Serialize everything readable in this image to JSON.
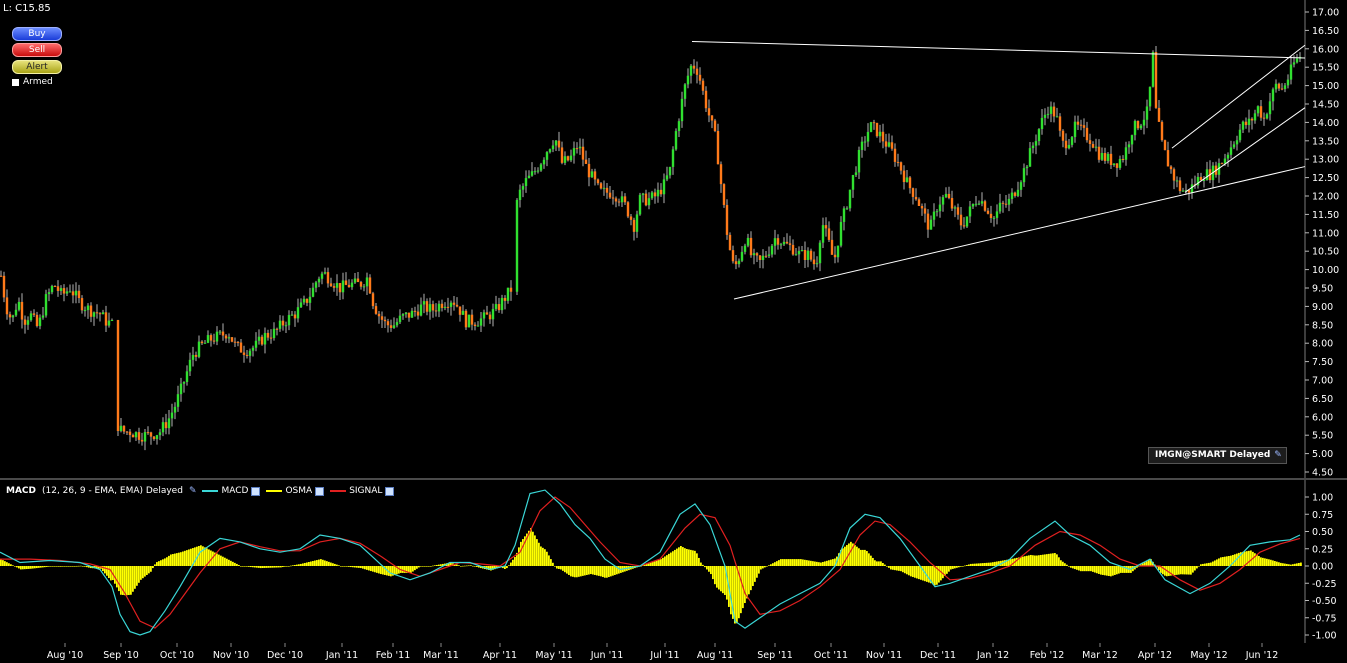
{
  "header": {
    "last_price": "L: C15.85"
  },
  "order_buttons": {
    "buy": "Buy",
    "sell": "Sell",
    "alert": "Alert",
    "armed": "Armed"
  },
  "ticker": {
    "label": "IMGN@SMART Delayed"
  },
  "macd_legend": {
    "title": "MACD",
    "params": "(12, 26, 9 - EMA, EMA) Delayed",
    "macd": "MACD",
    "osma": "OSMA",
    "signal": "SIGNAL"
  },
  "colors": {
    "up": "#30e030",
    "down": "#ff7a1a",
    "macd": "#3ad6d6",
    "signal": "#e02020",
    "osma": "#ffff00",
    "trendline": "#ffffff"
  },
  "chart_data": {
    "type": "candlestick",
    "x_labels": [
      "Aug '10",
      "Sep '10",
      "Oct '10",
      "Nov '10",
      "Dec '10",
      "Jan '11",
      "Feb '11",
      "Mar '11",
      "Apr '11",
      "May '11",
      "Jun '11",
      "Jul '11",
      "Aug '11",
      "Sep '11",
      "Oct '11",
      "Nov '11",
      "Dec '11",
      "Jan '12",
      "Feb '12",
      "Mar '12",
      "Apr '12",
      "May '12",
      "Jun '12"
    ],
    "price_axis": {
      "ylim": [
        4.5,
        17.0
      ],
      "ticks": [
        "17.00",
        "16.50",
        "16.00",
        "15.50",
        "15.00",
        "14.50",
        "14.00",
        "13.50",
        "13.00",
        "12.50",
        "12.00",
        "11.50",
        "11.00",
        "10.50",
        "10.00",
        "9.50",
        "9.00",
        "8.50",
        "8.00",
        "7.50",
        "7.00",
        "6.50",
        "6.00",
        "5.50",
        "5.00",
        "4.50"
      ]
    },
    "price_path": [
      [
        0,
        10.0
      ],
      [
        6,
        9.0
      ],
      [
        12,
        8.6
      ],
      [
        18,
        9.2
      ],
      [
        24,
        8.6
      ],
      [
        30,
        8.8
      ],
      [
        38,
        8.4
      ],
      [
        46,
        9.2
      ],
      [
        54,
        9.6
      ],
      [
        62,
        9.3
      ],
      [
        70,
        9.5
      ],
      [
        80,
        9.1
      ],
      [
        90,
        8.9
      ],
      [
        100,
        8.8
      ],
      [
        106,
        8.6
      ],
      [
        113,
        8.5
      ],
      [
        117,
        5.8
      ],
      [
        122,
        5.6
      ],
      [
        130,
        5.6
      ],
      [
        140,
        5.5
      ],
      [
        150,
        5.5
      ],
      [
        160,
        5.6
      ],
      [
        168,
        5.9
      ],
      [
        175,
        6.3
      ],
      [
        182,
        6.8
      ],
      [
        188,
        7.3
      ],
      [
        193,
        7.7
      ],
      [
        200,
        7.9
      ],
      [
        210,
        8.1
      ],
      [
        220,
        8.2
      ],
      [
        228,
        8.3
      ],
      [
        236,
        7.9
      ],
      [
        245,
        7.8
      ],
      [
        255,
        7.9
      ],
      [
        265,
        8.2
      ],
      [
        275,
        8.3
      ],
      [
        285,
        8.6
      ],
      [
        295,
        8.8
      ],
      [
        305,
        9.1
      ],
      [
        312,
        9.4
      ],
      [
        318,
        9.8
      ],
      [
        324,
        9.9
      ],
      [
        332,
        9.7
      ],
      [
        340,
        9.5
      ],
      [
        350,
        9.6
      ],
      [
        360,
        9.6
      ],
      [
        368,
        9.8
      ],
      [
        372,
        9.2
      ],
      [
        378,
        8.8
      ],
      [
        386,
        8.5
      ],
      [
        394,
        8.5
      ],
      [
        402,
        8.7
      ],
      [
        412,
        8.8
      ],
      [
        422,
        9.0
      ],
      [
        432,
        8.9
      ],
      [
        442,
        9.1
      ],
      [
        452,
        9.2
      ],
      [
        458,
        9.0
      ],
      [
        466,
        8.6
      ],
      [
        476,
        8.6
      ],
      [
        486,
        8.7
      ],
      [
        496,
        8.9
      ],
      [
        504,
        9.2
      ],
      [
        512,
        9.5
      ],
      [
        515,
        11.6
      ],
      [
        520,
        12.1
      ],
      [
        526,
        12.4
      ],
      [
        533,
        12.6
      ],
      [
        540,
        12.9
      ],
      [
        548,
        13.3
      ],
      [
        555,
        13.6
      ],
      [
        562,
        12.9
      ],
      [
        570,
        13.0
      ],
      [
        578,
        13.4
      ],
      [
        586,
        12.8
      ],
      [
        592,
        12.5
      ],
      [
        600,
        12.1
      ],
      [
        610,
        12.1
      ],
      [
        618,
        12.0
      ],
      [
        626,
        11.7
      ],
      [
        634,
        11.2
      ],
      [
        640,
        11.9
      ],
      [
        648,
        11.9
      ],
      [
        656,
        12.0
      ],
      [
        664,
        12.3
      ],
      [
        670,
        12.7
      ],
      [
        675,
        13.6
      ],
      [
        680,
        14.3
      ],
      [
        686,
        15.1
      ],
      [
        692,
        15.6
      ],
      [
        698,
        15.4
      ],
      [
        704,
        14.7
      ],
      [
        710,
        14.1
      ],
      [
        716,
        13.5
      ],
      [
        722,
        12.1
      ],
      [
        728,
        10.8
      ],
      [
        734,
        10.0
      ],
      [
        740,
        10.4
      ],
      [
        746,
        10.9
      ],
      [
        752,
        10.3
      ],
      [
        760,
        10.2
      ],
      [
        768,
        10.5
      ],
      [
        776,
        10.9
      ],
      [
        784,
        10.7
      ],
      [
        792,
        10.6
      ],
      [
        800,
        10.4
      ],
      [
        808,
        10.4
      ],
      [
        816,
        10.1
      ],
      [
        822,
        11.3
      ],
      [
        828,
        10.8
      ],
      [
        834,
        10.2
      ],
      [
        840,
        11.1
      ],
      [
        846,
        11.7
      ],
      [
        852,
        12.4
      ],
      [
        858,
        13.0
      ],
      [
        864,
        13.5
      ],
      [
        870,
        13.9
      ],
      [
        876,
        13.8
      ],
      [
        884,
        13.5
      ],
      [
        892,
        13.2
      ],
      [
        900,
        12.8
      ],
      [
        908,
        12.3
      ],
      [
        916,
        12.0
      ],
      [
        922,
        11.6
      ],
      [
        930,
        11.1
      ],
      [
        938,
        11.8
      ],
      [
        946,
        12.0
      ],
      [
        954,
        11.6
      ],
      [
        962,
        11.2
      ],
      [
        970,
        11.6
      ],
      [
        978,
        12.0
      ],
      [
        986,
        11.7
      ],
      [
        994,
        11.4
      ],
      [
        1000,
        11.7
      ],
      [
        1008,
        11.8
      ],
      [
        1016,
        12.2
      ],
      [
        1024,
        12.7
      ],
      [
        1032,
        13.3
      ],
      [
        1040,
        13.9
      ],
      [
        1048,
        14.4
      ],
      [
        1056,
        14.2
      ],
      [
        1062,
        13.4
      ],
      [
        1068,
        13.5
      ],
      [
        1076,
        13.9
      ],
      [
        1084,
        13.7
      ],
      [
        1092,
        13.5
      ],
      [
        1100,
        13.1
      ],
      [
        1108,
        13.0
      ],
      [
        1116,
        12.9
      ],
      [
        1124,
        13.1
      ],
      [
        1132,
        13.8
      ],
      [
        1140,
        14.0
      ],
      [
        1148,
        14.3
      ],
      [
        1153,
        15.8
      ],
      [
        1156,
        14.3
      ],
      [
        1162,
        13.4
      ],
      [
        1168,
        12.9
      ],
      [
        1174,
        12.5
      ],
      [
        1180,
        12.2
      ],
      [
        1186,
        12.1
      ],
      [
        1194,
        12.3
      ],
      [
        1202,
        12.6
      ],
      [
        1210,
        12.6
      ],
      [
        1218,
        12.8
      ],
      [
        1226,
        13.1
      ],
      [
        1234,
        13.5
      ],
      [
        1242,
        13.9
      ],
      [
        1250,
        14.0
      ],
      [
        1258,
        14.4
      ],
      [
        1264,
        14.1
      ],
      [
        1270,
        14.6
      ],
      [
        1276,
        15.0
      ],
      [
        1282,
        14.9
      ],
      [
        1288,
        15.2
      ],
      [
        1294,
        15.6
      ],
      [
        1300,
        15.8
      ]
    ],
    "trendlines": [
      {
        "name": "upper-resistance",
        "from": [
          692,
          16.2
        ],
        "to": [
          1305,
          15.75
        ]
      },
      {
        "name": "lower-support",
        "from": [
          734,
          9.2
        ],
        "to": [
          1305,
          12.8
        ]
      },
      {
        "name": "channel-top",
        "from": [
          1172,
          13.3
        ],
        "to": [
          1305,
          16.1
        ]
      },
      {
        "name": "channel-bottom",
        "from": [
          1185,
          12.1
        ],
        "to": [
          1305,
          14.4
        ]
      }
    ],
    "macd_axis": {
      "ylim": [
        -1.0,
        1.0
      ],
      "ticks": [
        "1.00",
        "0.75",
        "0.50",
        "0.25",
        "0.00",
        "-0.25",
        "-0.50",
        "-0.75",
        "-1.00"
      ]
    },
    "macd_path": [
      [
        0,
        0.2
      ],
      [
        20,
        0.05
      ],
      [
        50,
        0.08
      ],
      [
        80,
        0.05
      ],
      [
        100,
        -0.05
      ],
      [
        112,
        -0.3
      ],
      [
        120,
        -0.7
      ],
      [
        130,
        -0.95
      ],
      [
        140,
        -1.0
      ],
      [
        150,
        -0.95
      ],
      [
        165,
        -0.65
      ],
      [
        180,
        -0.3
      ],
      [
        200,
        0.2
      ],
      [
        220,
        0.4
      ],
      [
        240,
        0.35
      ],
      [
        260,
        0.25
      ],
      [
        280,
        0.2
      ],
      [
        300,
        0.25
      ],
      [
        320,
        0.45
      ],
      [
        340,
        0.4
      ],
      [
        360,
        0.3
      ],
      [
        375,
        0.1
      ],
      [
        390,
        -0.1
      ],
      [
        410,
        -0.2
      ],
      [
        430,
        -0.1
      ],
      [
        450,
        0.05
      ],
      [
        470,
        0.05
      ],
      [
        490,
        -0.05
      ],
      [
        505,
        0.0
      ],
      [
        515,
        0.3
      ],
      [
        530,
        1.05
      ],
      [
        545,
        1.1
      ],
      [
        560,
        0.9
      ],
      [
        575,
        0.6
      ],
      [
        590,
        0.4
      ],
      [
        605,
        0.1
      ],
      [
        620,
        -0.05
      ],
      [
        640,
        0.0
      ],
      [
        660,
        0.2
      ],
      [
        680,
        0.75
      ],
      [
        695,
        0.9
      ],
      [
        710,
        0.6
      ],
      [
        725,
        0.0
      ],
      [
        735,
        -0.8
      ],
      [
        745,
        -0.9
      ],
      [
        760,
        -0.75
      ],
      [
        780,
        -0.55
      ],
      [
        800,
        -0.4
      ],
      [
        820,
        -0.25
      ],
      [
        835,
        0.0
      ],
      [
        850,
        0.55
      ],
      [
        865,
        0.75
      ],
      [
        880,
        0.7
      ],
      [
        900,
        0.4
      ],
      [
        920,
        0.0
      ],
      [
        935,
        -0.3
      ],
      [
        950,
        -0.25
      ],
      [
        970,
        -0.15
      ],
      [
        990,
        -0.05
      ],
      [
        1010,
        0.1
      ],
      [
        1030,
        0.4
      ],
      [
        1055,
        0.65
      ],
      [
        1070,
        0.45
      ],
      [
        1090,
        0.3
      ],
      [
        1110,
        0.05
      ],
      [
        1130,
        -0.05
      ],
      [
        1150,
        0.1
      ],
      [
        1165,
        -0.2
      ],
      [
        1190,
        -0.4
      ],
      [
        1210,
        -0.25
      ],
      [
        1230,
        0.0
      ],
      [
        1250,
        0.3
      ],
      [
        1270,
        0.35
      ],
      [
        1290,
        0.38
      ],
      [
        1300,
        0.45
      ]
    ],
    "signal_path": [
      [
        0,
        0.1
      ],
      [
        30,
        0.1
      ],
      [
        60,
        0.08
      ],
      [
        90,
        0.03
      ],
      [
        110,
        -0.05
      ],
      [
        125,
        -0.4
      ],
      [
        140,
        -0.8
      ],
      [
        155,
        -0.9
      ],
      [
        170,
        -0.7
      ],
      [
        185,
        -0.4
      ],
      [
        200,
        -0.1
      ],
      [
        220,
        0.25
      ],
      [
        240,
        0.35
      ],
      [
        260,
        0.28
      ],
      [
        280,
        0.22
      ],
      [
        300,
        0.22
      ],
      [
        320,
        0.35
      ],
      [
        340,
        0.4
      ],
      [
        360,
        0.33
      ],
      [
        380,
        0.15
      ],
      [
        400,
        -0.05
      ],
      [
        420,
        -0.15
      ],
      [
        440,
        -0.05
      ],
      [
        460,
        0.05
      ],
      [
        480,
        0.03
      ],
      [
        500,
        0.0
      ],
      [
        520,
        0.2
      ],
      [
        540,
        0.8
      ],
      [
        555,
        1.0
      ],
      [
        570,
        0.85
      ],
      [
        585,
        0.6
      ],
      [
        600,
        0.35
      ],
      [
        620,
        0.05
      ],
      [
        640,
        0.0
      ],
      [
        660,
        0.1
      ],
      [
        685,
        0.55
      ],
      [
        700,
        0.75
      ],
      [
        715,
        0.7
      ],
      [
        730,
        0.3
      ],
      [
        745,
        -0.4
      ],
      [
        760,
        -0.7
      ],
      [
        780,
        -0.65
      ],
      [
        800,
        -0.5
      ],
      [
        820,
        -0.3
      ],
      [
        840,
        -0.05
      ],
      [
        860,
        0.45
      ],
      [
        875,
        0.65
      ],
      [
        890,
        0.6
      ],
      [
        910,
        0.35
      ],
      [
        930,
        0.05
      ],
      [
        950,
        -0.2
      ],
      [
        970,
        -0.18
      ],
      [
        990,
        -0.1
      ],
      [
        1010,
        0.0
      ],
      [
        1035,
        0.3
      ],
      [
        1060,
        0.5
      ],
      [
        1080,
        0.45
      ],
      [
        1100,
        0.3
      ],
      [
        1120,
        0.1
      ],
      [
        1140,
        0.0
      ],
      [
        1160,
        0.0
      ],
      [
        1180,
        -0.2
      ],
      [
        1200,
        -0.35
      ],
      [
        1220,
        -0.25
      ],
      [
        1240,
        -0.05
      ],
      [
        1260,
        0.2
      ],
      [
        1280,
        0.32
      ],
      [
        1300,
        0.4
      ]
    ]
  }
}
